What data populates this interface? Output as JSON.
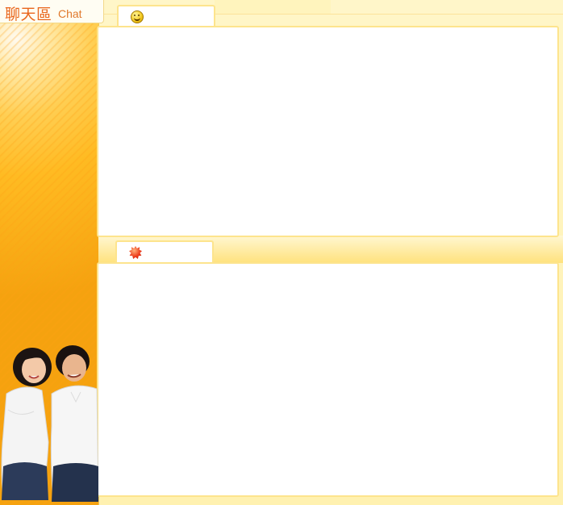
{
  "brand": {
    "title": "聊天區",
    "subtitle": "Chat"
  },
  "tabs": {
    "top_icon": "smiley-icon",
    "bottom_icon": "red-starburst-icon"
  },
  "colors": {
    "brand_text": "#e9661c",
    "accent_orange": "#ffbb22",
    "border_yellow": "#fde48d",
    "background_cream": "#fff6c8"
  }
}
